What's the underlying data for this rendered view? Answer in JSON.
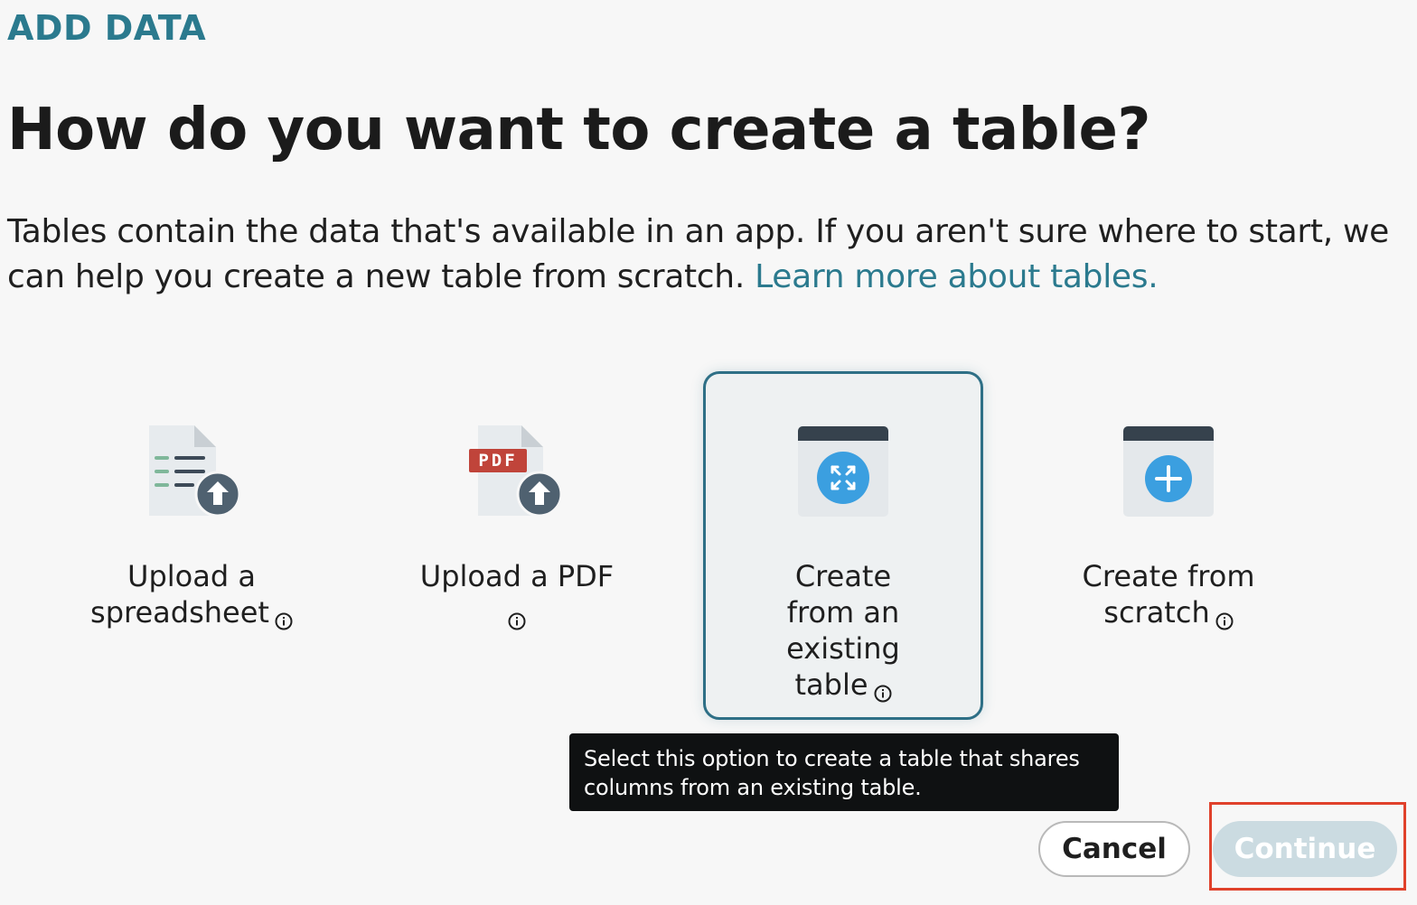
{
  "header": {
    "eyebrow": "ADD DATA",
    "title": "How do you want to create a table?",
    "description": "Tables contain the data that's available in an app. If you aren't sure where to start, we can help you create a new table from scratch.",
    "learn_more_link": "Learn more about tables."
  },
  "options": [
    {
      "label": "Upload a spreadsheet",
      "icon": "spreadsheet-upload-icon",
      "selected": false
    },
    {
      "label": "Upload a PDF",
      "icon": "pdf-upload-icon",
      "pdf_badge": "PDF",
      "selected": false
    },
    {
      "label": "Create from an existing table",
      "icon": "existing-table-icon",
      "selected": true
    },
    {
      "label": "Create from scratch",
      "icon": "new-table-icon",
      "selected": false
    }
  ],
  "tooltip": {
    "text": "Select this option to create a table that shares columns from an existing table."
  },
  "footer": {
    "cancel_label": "Cancel",
    "continue_label": "Continue",
    "continue_enabled": false
  },
  "colors": {
    "accent": "#2b7a8e",
    "selected_border": "#2e6f86",
    "icon_blue": "#3b9fe0",
    "icon_dark": "#3d4a58",
    "pdf_red": "#c0443a",
    "highlight": "#e0412b"
  }
}
